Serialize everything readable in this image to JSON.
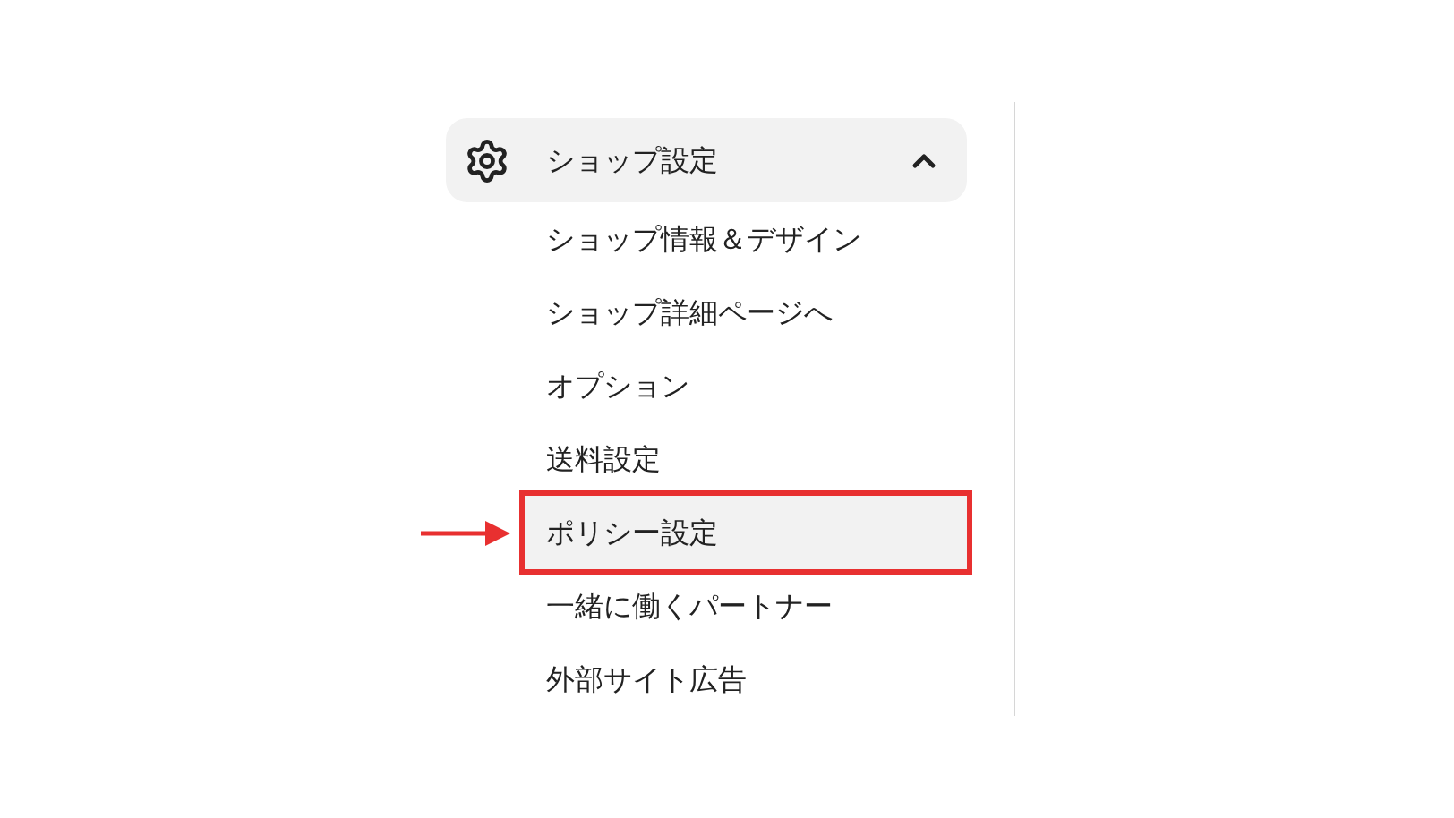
{
  "menu": {
    "header": {
      "label": "ショップ設定",
      "expanded": true
    },
    "items": [
      {
        "label": "ショップ情報＆デザイン",
        "selected": false,
        "callout": false
      },
      {
        "label": "ショップ詳細ページへ",
        "selected": false,
        "callout": false
      },
      {
        "label": "オプション",
        "selected": false,
        "callout": false
      },
      {
        "label": "送料設定",
        "selected": false,
        "callout": false
      },
      {
        "label": "ポリシー設定",
        "selected": true,
        "callout": true
      },
      {
        "label": "一緒に働くパートナー",
        "selected": false,
        "callout": false
      },
      {
        "label": "外部サイト広告",
        "selected": false,
        "callout": false
      }
    ]
  }
}
